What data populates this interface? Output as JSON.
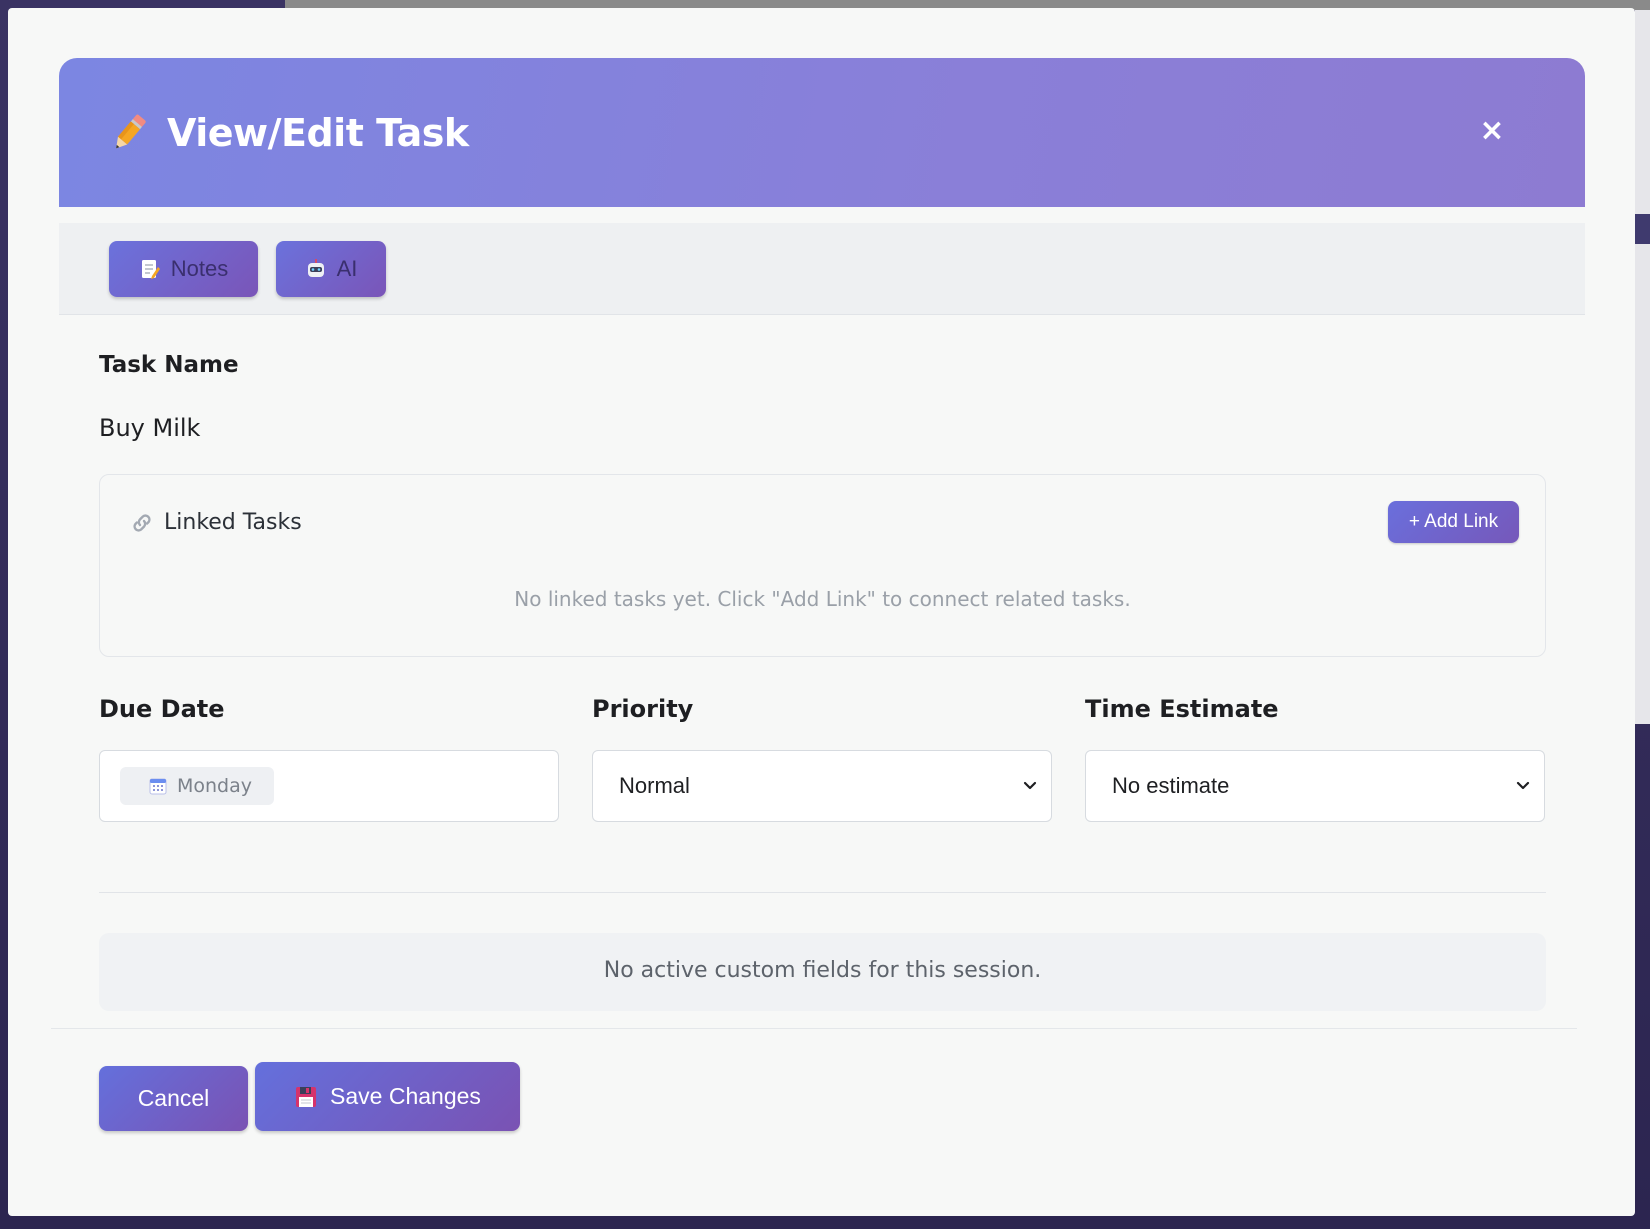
{
  "modal": {
    "title": "View/Edit Task",
    "close_label": "×"
  },
  "toolbar": {
    "notes_label": "Notes",
    "ai_label": "AI"
  },
  "task": {
    "name_label": "Task Name",
    "name_value": "Buy Milk"
  },
  "linked_tasks": {
    "title": "Linked Tasks",
    "add_link_label": "+ Add Link",
    "empty_message": "No linked tasks yet. Click \"Add Link\" to connect related tasks."
  },
  "fields": {
    "due_date_label": "Due Date",
    "due_date_value": "Monday",
    "priority_label": "Priority",
    "priority_value": "Normal",
    "time_estimate_label": "Time Estimate",
    "time_estimate_value": "No estimate"
  },
  "custom_fields": {
    "empty_message": "No active custom fields for this session."
  },
  "footer": {
    "cancel_label": "Cancel",
    "save_label": "Save Changes"
  },
  "icons": {
    "header": "pencil-icon",
    "notes": "memo-icon",
    "ai": "robot-icon",
    "linked": "link-icon",
    "calendar": "calendar-icon",
    "save": "floppy-disk-icon"
  },
  "colors": {
    "header_gradient_start": "#7c86e2",
    "header_gradient_end": "#8d7bd2",
    "button_gradient_start": "#6470dc",
    "button_gradient_end": "#7a52b3"
  }
}
